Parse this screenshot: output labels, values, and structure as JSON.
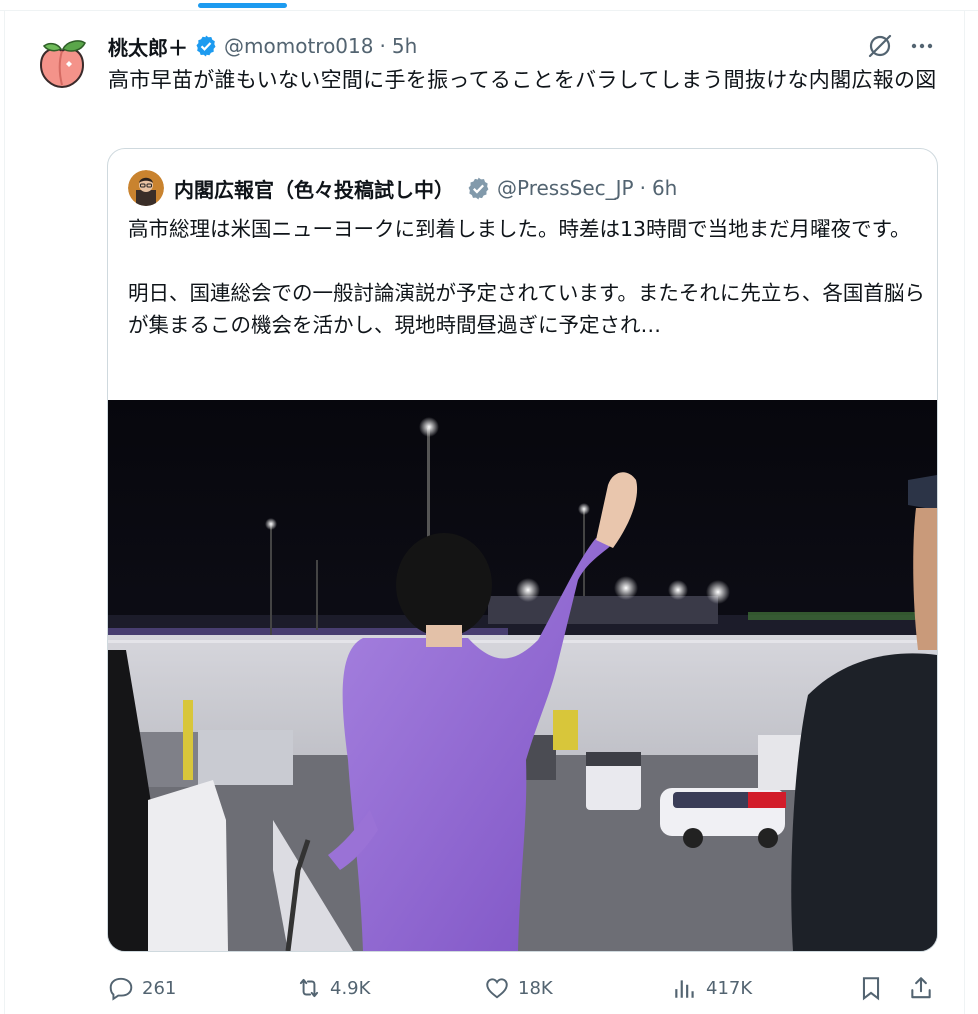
{
  "tweet": {
    "author_name": "桃太郎＋",
    "handle": "@momotro018",
    "time": "5h",
    "text": "高市早苗が誰もいない空間に手を振ってることをバラしてしまう間抜けな内閣広報の図"
  },
  "quote": {
    "author_name": "内閣広報官（色々投稿試し中）",
    "handle": "@PressSec_JP",
    "time": "6h",
    "paragraphs": [
      "高市総理は米国ニューヨークに到着しました。時差は13時間で当地まだ月曜夜です。",
      "明日、国連総会での一般討論演説が予定されています。またそれに先立ち、各国首脳らが集まるこの機会を活かし、現地時間昼過ぎに予定され…"
    ]
  },
  "actions": {
    "replies": "261",
    "retweets": "4.9K",
    "likes": "18K",
    "views": "417K"
  },
  "icons": [
    "peach-avatar-icon",
    "verified-badge-icon",
    "grok-icon",
    "more-icon",
    "reply-icon",
    "retweet-icon",
    "like-icon",
    "views-icon",
    "bookmark-icon",
    "share-icon"
  ],
  "colors": {
    "accent": "#1d9bf0",
    "text": "#0f1419",
    "muted": "#536471",
    "border": "#cfd9de",
    "suit": "#9b6fd6"
  }
}
